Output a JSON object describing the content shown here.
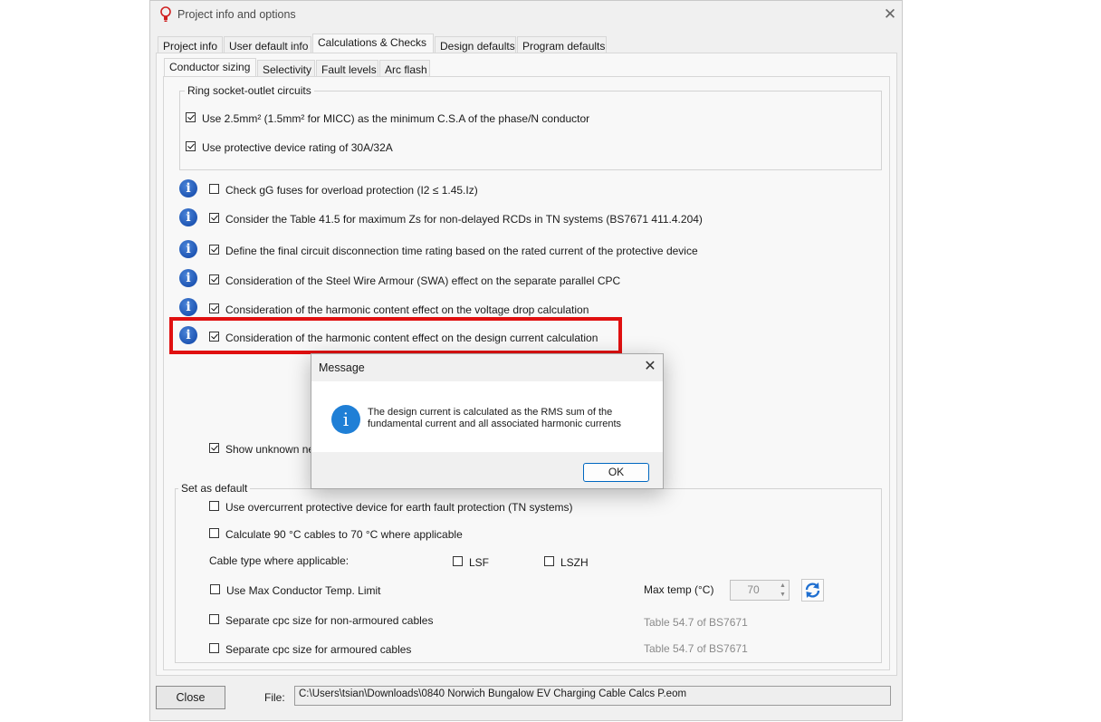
{
  "window": {
    "title": "Project info and options"
  },
  "main_tabs": [
    "Project info",
    "User default info",
    "Calculations & Checks",
    "Design defaults",
    "Program defaults"
  ],
  "sub_tabs": [
    "Conductor sizing",
    "Selectivity",
    "Fault levels",
    "Arc flash"
  ],
  "ring_group": {
    "legend": "Ring socket-outlet circuits",
    "items": [
      {
        "label": "Use 2.5mm² (1.5mm² for MICC) as the minimum C.S.A of the phase/N conductor",
        "checked": true
      },
      {
        "label": "Use protective device rating of 30A/32A",
        "checked": true
      }
    ]
  },
  "checks": [
    {
      "label": "Check gG fuses for overload protection (I2 ≤ 1.45.Iz)",
      "checked": false
    },
    {
      "label": "Consider the Table 41.5 for maximum Zs for non-delayed RCDs in TN systems (BS7671 411.4.204)",
      "checked": true
    },
    {
      "label": "Define the final circuit disconnection time rating based on the rated current of the protective device",
      "checked": true
    },
    {
      "label": "Consideration of the Steel Wire Armour (SWA) effect on the separate parallel CPC",
      "checked": true
    },
    {
      "label": "Consideration of the harmonic content effect on the voltage drop calculation",
      "checked": true
    },
    {
      "label": "Consideration of the harmonic content effect on the design current calculation",
      "checked": true
    }
  ],
  "show_unknown": {
    "label": "Show unknown ne",
    "checked": true
  },
  "defaults_group": {
    "legend": "Set as default",
    "overcurrent": {
      "label": "Use overcurrent protective device for earth fault protection (TN systems)",
      "checked": false
    },
    "calc90": {
      "label": "Calculate 90 °C cables to 70 °C where applicable",
      "checked": false
    },
    "cable_type_label": "Cable type where applicable:",
    "lsf": {
      "label": "LSF",
      "checked": false
    },
    "lszh": {
      "label": "LSZH",
      "checked": false
    },
    "max_temp_limit": {
      "label": "Use Max Conductor Temp. Limit",
      "checked": false
    },
    "max_temp_label": "Max temp (°C)",
    "max_temp_value": "70",
    "sep_nonarmoured": {
      "label": "Separate cpc size for non-armoured cables",
      "checked": false
    },
    "sep_armoured": {
      "label": "Separate cpc size for armoured cables",
      "checked": false
    },
    "table_ref_1": "Table 54.7 of BS7671",
    "table_ref_2": "Table 54.7 of BS7671"
  },
  "footer": {
    "close_label": "Close",
    "file_label": "File:",
    "file_path": "C:\\Users\\tsian\\Downloads\\0840 Norwich Bungalow EV Charging Cable Calcs P.eom"
  },
  "dialog": {
    "title": "Message",
    "message_line1": "The design current is calculated as the RMS sum of the",
    "message_line2": "fundamental current and all associated harmonic currents",
    "ok_label": "OK"
  },
  "colors": {
    "highlight": "#e01010",
    "info_blue": "#1f56b4",
    "dialog_icon": "#1f7fd6",
    "ok_border": "#0067c0"
  }
}
